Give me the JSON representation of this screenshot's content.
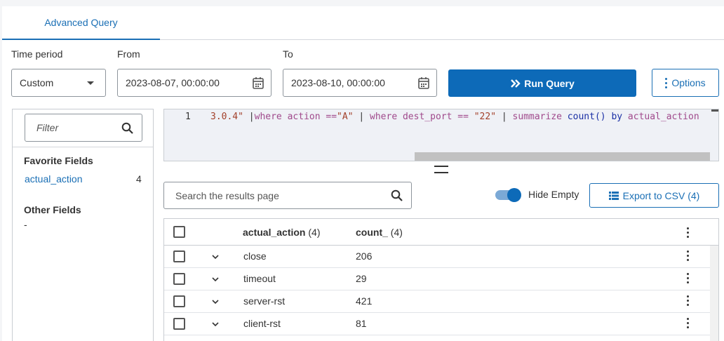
{
  "tabs": [
    {
      "label": "Advanced Query",
      "active": true
    }
  ],
  "time_period": {
    "label": "Time period",
    "value": "Custom"
  },
  "from": {
    "label": "From",
    "value": "2023-08-07, 00:00:00"
  },
  "to": {
    "label": "To",
    "value": "2023-08-10, 00:00:00"
  },
  "run_query_label": "Run Query",
  "options_label": "Options",
  "sidebar": {
    "filter_placeholder": "Filter",
    "favorite_title": "Favorite Fields",
    "favorites": [
      {
        "name": "actual_action",
        "count": "4"
      }
    ],
    "other_title": "Other Fields",
    "other_value": "-"
  },
  "editor": {
    "line_number": "1",
    "tokens": {
      "t1": "3.0.4\"",
      "t2": " |",
      "t3": "where",
      "t4": " action ==",
      "t5": "\"A\"",
      "t6": " | ",
      "t7": "where",
      "t8": " dest_port == ",
      "t9": "\"22\"",
      "t10": " | ",
      "t11": "summarize",
      "t12": " count() ",
      "t13": "by",
      "t14": " actual_action"
    }
  },
  "results": {
    "search_placeholder": "Search the results page",
    "hide_empty_label": "Hide Empty",
    "hide_empty_on": true,
    "export_label": "Export to CSV (4)",
    "columns": [
      {
        "name": "actual_action",
        "count": "(4)"
      },
      {
        "name": "count_",
        "count": "(4)"
      }
    ],
    "rows": [
      {
        "actual_action": "close",
        "count_": "206"
      },
      {
        "actual_action": "timeout",
        "count_": "29"
      },
      {
        "actual_action": "server-rst",
        "count_": "421"
      },
      {
        "actual_action": "client-rst",
        "count_": "81"
      }
    ]
  },
  "colors": {
    "accent": "#0d6ab8",
    "link": "#1a6fb5"
  }
}
